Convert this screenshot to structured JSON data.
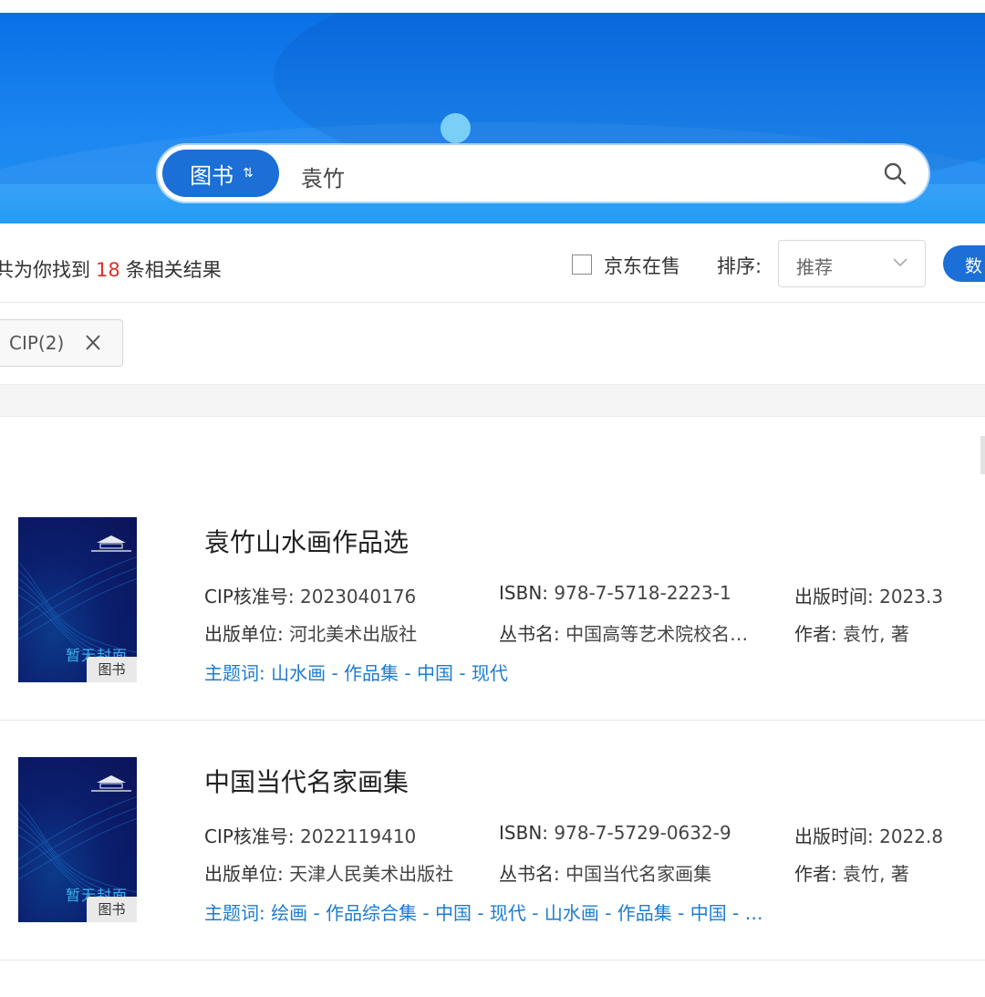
{
  "search": {
    "scope_label": "图书",
    "scope_swap_glyph": "⇅",
    "query": "袁竹",
    "icon": "search-icon"
  },
  "results": {
    "prefix": "共为你找到",
    "count": "18",
    "suffix": "条相关结果"
  },
  "filters": {
    "jd_label": "京东在售",
    "sort_label": "排序:",
    "sort_value": "推荐",
    "data_button": "数"
  },
  "active_filter": {
    "label": "CIP(2)",
    "remove_icon": "close-icon"
  },
  "items": [
    {
      "title": "袁竹山水画作品选",
      "cip_label": "CIP核准号:",
      "cip_value": "2023040176",
      "isbn_label": "ISBN:",
      "isbn_value": "978-7-5718-2223-1",
      "date_label": "出版时间:",
      "date_value": "2023.3",
      "publisher_label": "出版单位:",
      "publisher_value": "河北美术出版社",
      "series_label": "丛书名:",
      "series_value": "中国高等艺术院校名…",
      "author_label": "作者:",
      "author_value": "袁竹, 著",
      "subject_label": "主题词:",
      "subject_value": "山水画 - 作品集 - 中国 - 现代",
      "cover_text": "暂无封面",
      "cover_badge": "图书"
    },
    {
      "title": "中国当代名家画集",
      "cip_label": "CIP核准号:",
      "cip_value": "2022119410",
      "isbn_label": "ISBN:",
      "isbn_value": "978-7-5729-0632-9",
      "date_label": "出版时间:",
      "date_value": "2022.8",
      "publisher_label": "出版单位:",
      "publisher_value": "天津人民美术出版社",
      "series_label": "丛书名:",
      "series_value": "中国当代名家画集",
      "author_label": "作者:",
      "author_value": "袁竹, 著",
      "subject_label": "主题词:",
      "subject_value": "绘画 - 作品综合集 - 中国 - 现代 - 山水画 - 作品集 - 中国 - …",
      "cover_text": "暂无封面",
      "cover_badge": "图书"
    }
  ],
  "colors": {
    "brand_blue": "#1b6fd6",
    "count_red": "#e0302a",
    "link_blue": "#1b7cd0"
  }
}
